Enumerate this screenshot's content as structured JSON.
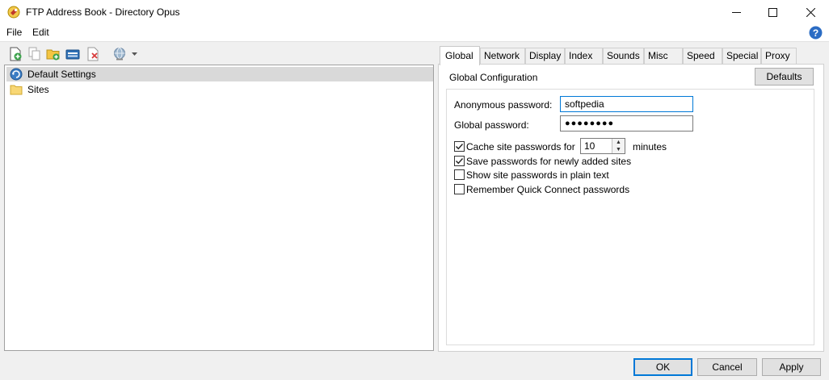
{
  "window": {
    "title": "FTP Address Book - Directory Opus"
  },
  "menu": {
    "file": "File",
    "edit": "Edit"
  },
  "tree": [
    {
      "label": "Default Settings",
      "selected": true
    },
    {
      "label": "Sites",
      "selected": false
    }
  ],
  "tabs": [
    "Global",
    "Network",
    "Display",
    "Index",
    "Sounds",
    "Misc",
    "Speed",
    "Special",
    "Proxy"
  ],
  "global": {
    "heading": "Global Configuration",
    "defaults_label": "Defaults",
    "anonymous_password_label": "Anonymous password:",
    "anonymous_password_value": "softpedia",
    "global_password_label": "Global password:",
    "global_password_value": "●●●●●●●●",
    "cache_label": "Cache site passwords for",
    "cache_minutes": "10",
    "minutes_label": "minutes",
    "options": [
      {
        "label": "Save passwords for newly added sites",
        "checked": true
      },
      {
        "label": "Show site passwords in plain text",
        "checked": false
      },
      {
        "label": "Remember Quick Connect passwords",
        "checked": false
      }
    ],
    "cache_checked": true
  },
  "buttons": {
    "ok": "OK",
    "cancel": "Cancel",
    "apply": "Apply"
  },
  "colors": {
    "accent": "#0078d7",
    "selection": "#d9d9d9"
  }
}
